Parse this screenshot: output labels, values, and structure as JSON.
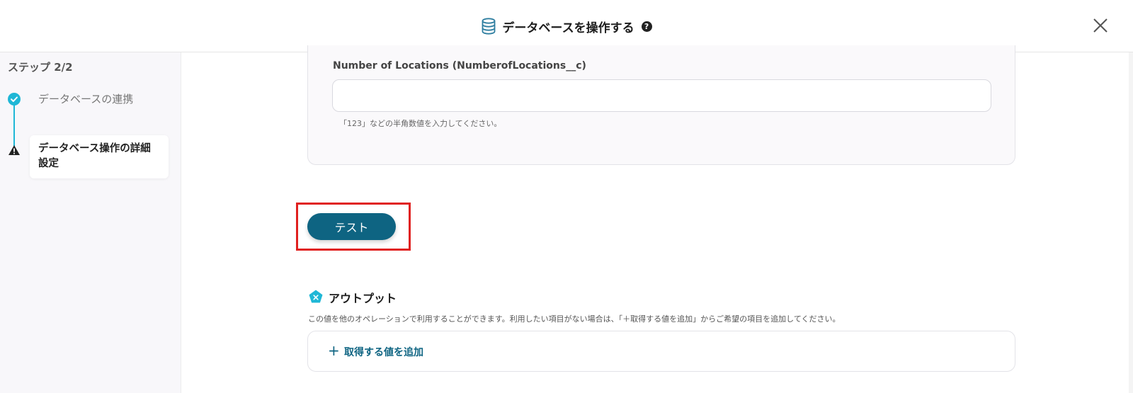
{
  "header": {
    "title": "データベースを操作する",
    "help_glyph": "?",
    "db_icon": "database-icon",
    "close_icon": "close-icon"
  },
  "sidebar": {
    "step_label": "ステップ 2/2",
    "steps": [
      {
        "label": "データベースの連携",
        "status": "complete",
        "icon": "check-icon"
      },
      {
        "label": "データベース操作の詳細設定",
        "status": "warning",
        "icon": "warning-icon"
      }
    ]
  },
  "form": {
    "field_label": "Number of Locations (NumberofLocations__c)",
    "field_value": "",
    "field_hint": "「123」などの半角数値を入力してください。"
  },
  "actions": {
    "test_label": "テスト",
    "highlight_color": "#e0201f",
    "button_color": "#0e6482"
  },
  "output": {
    "title": "アウトプット",
    "description": "この値を他のオペレーションで利用することができます。利用したい項目がない場合は、「＋取得する値を追加」からご希望の項目を追加してください。",
    "add_plus": "+",
    "add_label": "取得する値を追加",
    "icon": "output-pentagon-icon",
    "accent_color": "#1fb7d6"
  }
}
